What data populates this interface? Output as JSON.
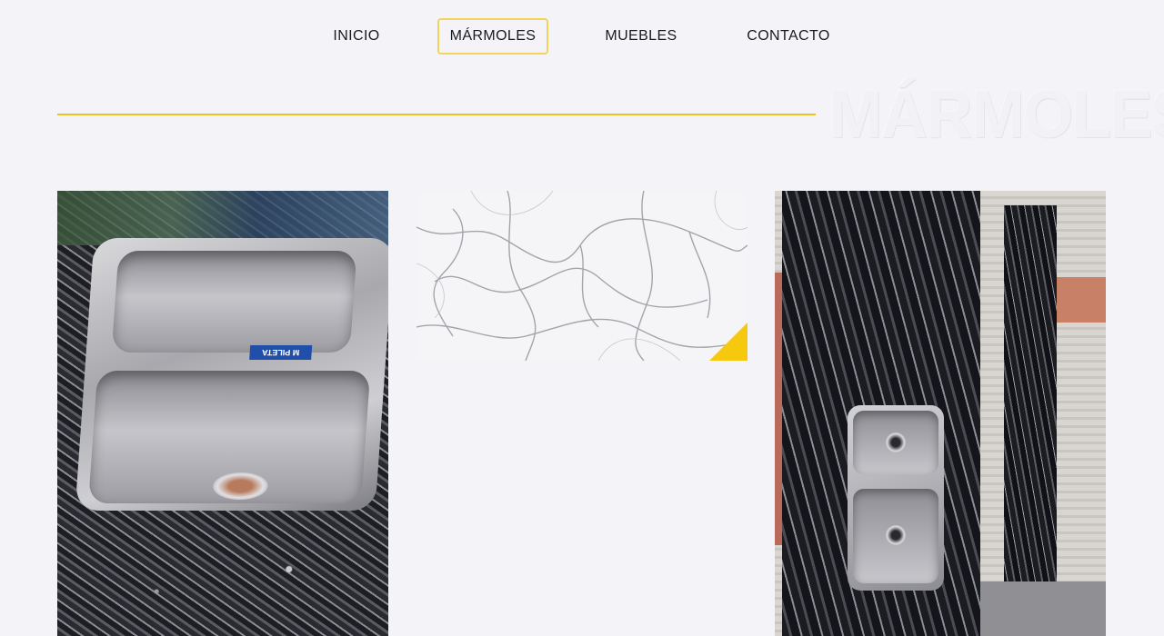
{
  "nav": {
    "items": [
      {
        "label": "INICIO"
      },
      {
        "label": "MÁRMOLES"
      },
      {
        "label": "MUEBLES"
      },
      {
        "label": "CONTACTO"
      }
    ],
    "active_index": 1
  },
  "section": {
    "title": "MÁRMOLES"
  },
  "gallery": {
    "items": [
      {
        "subject": "double-sink-granite"
      },
      {
        "subject": "white-marble"
      },
      {
        "subject": "black-granite-slab-with-sink",
        "sticker": "M PILETA"
      }
    ]
  },
  "colors": {
    "accent": "#efc21a",
    "active_border": "#f2d35b",
    "background": "#f4f4f8"
  }
}
